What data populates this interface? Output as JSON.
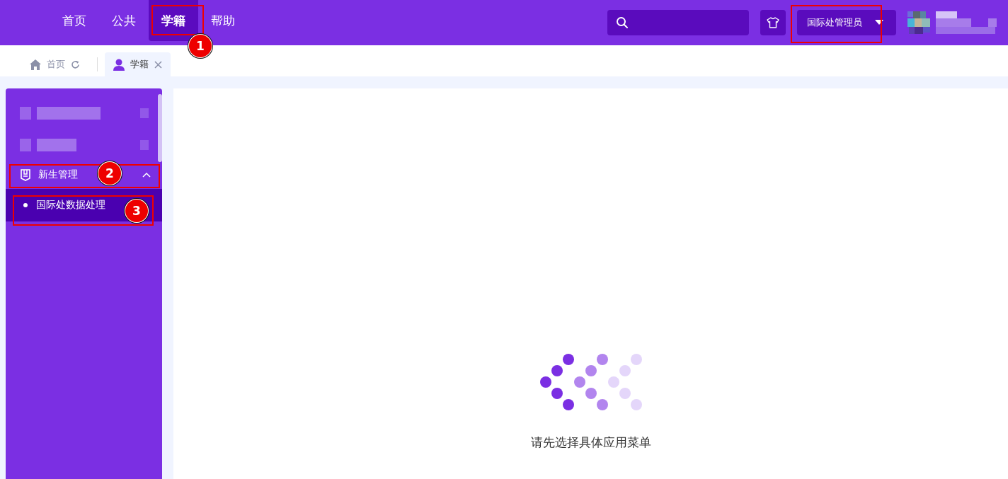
{
  "top_nav": [
    {
      "label": "首页",
      "selected": false
    },
    {
      "label": "公共",
      "selected": false
    },
    {
      "label": "学籍",
      "selected": true
    },
    {
      "label": "帮助",
      "selected": false
    }
  ],
  "role_select": {
    "value": "国际处管理员"
  },
  "tabs": [
    {
      "label": "首页",
      "selected": false,
      "kind": "home"
    },
    {
      "label": "学籍",
      "selected": true,
      "kind": "module"
    }
  ],
  "sidebar": {
    "items": [
      {
        "kind": "redacted"
      },
      {
        "kind": "redacted"
      },
      {
        "kind": "group",
        "label": "新生管理",
        "expanded": true,
        "children": [
          {
            "label": "国际处数据处理",
            "selected": true
          }
        ]
      }
    ]
  },
  "empty_state": {
    "message": "请先选择具体应用菜单"
  },
  "callouts": [
    {
      "number": "1"
    },
    {
      "number": "2"
    },
    {
      "number": "3"
    }
  ]
}
